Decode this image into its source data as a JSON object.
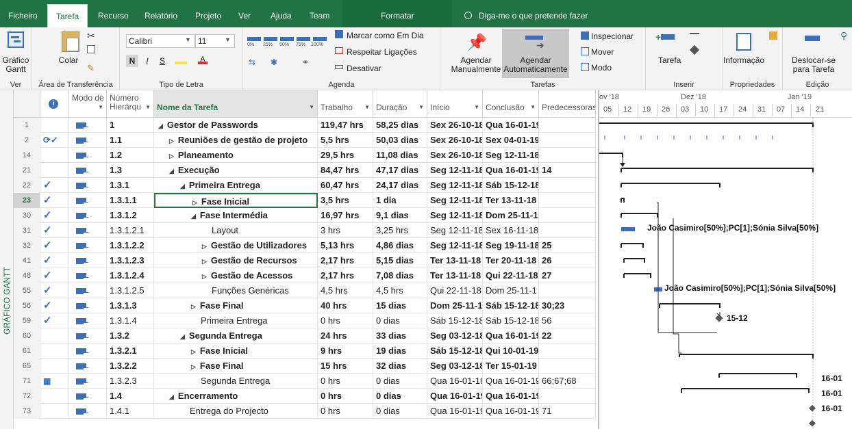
{
  "tabs": [
    "Ficheiro",
    "Tarefa",
    "Recurso",
    "Relatório",
    "Projeto",
    "Ver",
    "Ajuda",
    "Team"
  ],
  "active_tab": "Tarefa",
  "context_tab": "Formatar",
  "tell_me": "Diga-me o que pretende fazer",
  "ribbon": {
    "ver": {
      "button": "Gráfico Gantt",
      "label": "Ver"
    },
    "clipboard": {
      "paste": "Colar",
      "label": "Área de Transferência"
    },
    "font": {
      "family": "Calibri",
      "size": "11",
      "bold": "N",
      "italic": "I",
      "underline": "S",
      "label": "Tipo de Letra"
    },
    "schedule": {
      "mark": "Marcar como Em Dia",
      "respect": "Respeitar Ligações",
      "deactivate": "Desativar",
      "label": "Agenda",
      "percents": [
        "0%",
        "25%",
        "50%",
        "75%",
        "100%"
      ]
    },
    "tasks": {
      "manual": "Agendar Manualmente",
      "auto": "Agendar Automaticamente",
      "inspect": "Inspecionar",
      "move": "Mover",
      "mode": "Modo",
      "label": "Tarefas"
    },
    "insert": {
      "task": "Tarefa",
      "label": "Inserir"
    },
    "properties": {
      "info": "Informação",
      "label": "Propriedades"
    },
    "edit": {
      "scroll": "Deslocar-se para Tarefa",
      "label": "Edição"
    }
  },
  "side_label": "GRÁFICO GANTT",
  "columns": {
    "mode": "Modo de",
    "number": "Número Hierárqu",
    "name": "Nome da Tarefa",
    "work": "Trabalho",
    "duration": "Duração",
    "start": "Início",
    "finish": "Conclusão",
    "pred": "Predecessoras"
  },
  "rows": [
    {
      "id": "1",
      "ind": "",
      "num": "1",
      "indent": 0,
      "arrow": "◢",
      "name": "Gestor de Passwords",
      "work": "119,47 hrs",
      "dur": "58,25 dias",
      "start": "Sex 26-10-18",
      "finish": "Qua 16-01-19",
      "pred": "",
      "bold": true
    },
    {
      "id": "2",
      "ind": "⟳✓",
      "num": "1.1",
      "indent": 1,
      "arrow": "▷",
      "name": "Reuniões de gestão de projeto",
      "work": "5,5 hrs",
      "dur": "50,03 dias",
      "start": "Sex 26-10-18",
      "finish": "Sex 04-01-19",
      "pred": "",
      "bold": true
    },
    {
      "id": "14",
      "ind": "",
      "num": "1.2",
      "indent": 1,
      "arrow": "▷",
      "name": "Planeamento",
      "work": "29,5 hrs",
      "dur": "11,08 dias",
      "start": "Sex 26-10-18",
      "finish": "Seg 12-11-18",
      "pred": "",
      "bold": true
    },
    {
      "id": "21",
      "ind": "",
      "num": "1.3",
      "indent": 1,
      "arrow": "◢",
      "name": "Execução",
      "work": "84,47 hrs",
      "dur": "47,17 dias",
      "start": "Seg 12-11-18",
      "finish": "Qua 16-01-19",
      "pred": "14",
      "bold": true
    },
    {
      "id": "22",
      "ind": "✓",
      "num": "1.3.1",
      "indent": 2,
      "arrow": "◢",
      "name": "Primeira Entrega",
      "work": "60,47 hrs",
      "dur": "24,17 dias",
      "start": "Seg 12-11-18",
      "finish": "Sáb 15-12-18",
      "pred": "",
      "bold": true
    },
    {
      "id": "23",
      "ind": "✓",
      "num": "1.3.1.1",
      "indent": 3,
      "arrow": "▷",
      "name": "Fase Inicial",
      "work": "3,5 hrs",
      "dur": "1 dia",
      "start": "Seg 12-11-18",
      "finish": "Ter 13-11-18",
      "pred": "",
      "bold": true,
      "selected": true
    },
    {
      "id": "30",
      "ind": "✓",
      "num": "1.3.1.2",
      "indent": 3,
      "arrow": "◢",
      "name": "Fase Intermédia",
      "work": "16,97 hrs",
      "dur": "9,1 dias",
      "start": "Seg 12-11-18",
      "finish": "Dom 25-11-1",
      "pred": "",
      "bold": true
    },
    {
      "id": "31",
      "ind": "✓",
      "num": "1.3.1.2.1",
      "indent": 4,
      "arrow": "",
      "name": "Layout",
      "work": "3 hrs",
      "dur": "3,25 hrs",
      "start": "Seg 12-11-18",
      "finish": "Sex 16-11-18",
      "pred": "",
      "bold": false
    },
    {
      "id": "32",
      "ind": "✓",
      "num": "1.3.1.2.2",
      "indent": 4,
      "arrow": "▷",
      "name": "Gestão de Utilizadores",
      "work": "5,13 hrs",
      "dur": "4,86 dias",
      "start": "Seg 12-11-18",
      "finish": "Seg 19-11-18",
      "pred": "25",
      "bold": true
    },
    {
      "id": "41",
      "ind": "✓",
      "num": "1.3.1.2.3",
      "indent": 4,
      "arrow": "▷",
      "name": "Gestão de Recursos",
      "work": "2,17 hrs",
      "dur": "5,15 dias",
      "start": "Ter 13-11-18",
      "finish": "Ter 20-11-18",
      "pred": "26",
      "bold": true
    },
    {
      "id": "48",
      "ind": "✓",
      "num": "1.3.1.2.4",
      "indent": 4,
      "arrow": "▷",
      "name": "Gestão de Acessos",
      "work": "2,17 hrs",
      "dur": "7,08 dias",
      "start": "Ter 13-11-18",
      "finish": "Qui 22-11-18",
      "pred": "27",
      "bold": true
    },
    {
      "id": "55",
      "ind": "✓",
      "num": "1.3.1.2.5",
      "indent": 4,
      "arrow": "",
      "name": "Funções Genéricas",
      "work": "4,5 hrs",
      "dur": "4,5 hrs",
      "start": "Qui 22-11-18",
      "finish": "Dom 25-11-1",
      "pred": "",
      "bold": false
    },
    {
      "id": "56",
      "ind": "✓",
      "num": "1.3.1.3",
      "indent": 3,
      "arrow": "▷",
      "name": "Fase Final",
      "work": "40 hrs",
      "dur": "15 dias",
      "start": "Dom 25-11-1",
      "finish": "Sáb 15-12-18",
      "pred": "30;23",
      "bold": true
    },
    {
      "id": "59",
      "ind": "✓",
      "num": "1.3.1.4",
      "indent": 3,
      "arrow": "",
      "name": "Primeira Entrega",
      "work": "0 hrs",
      "dur": "0 dias",
      "start": "Sáb 15-12-18",
      "finish": "Sáb 15-12-18",
      "pred": "56",
      "bold": false
    },
    {
      "id": "60",
      "ind": "",
      "num": "1.3.2",
      "indent": 2,
      "arrow": "◢",
      "name": "Segunda Entrega",
      "work": "24 hrs",
      "dur": "33 dias",
      "start": "Seg 03-12-18",
      "finish": "Qua 16-01-19",
      "pred": "22",
      "bold": true
    },
    {
      "id": "61",
      "ind": "",
      "num": "1.3.2.1",
      "indent": 3,
      "arrow": "▷",
      "name": "Fase Inicial",
      "work": "9 hrs",
      "dur": "19 dias",
      "start": "Sáb 15-12-18",
      "finish": "Qui 10-01-19",
      "pred": "",
      "bold": true
    },
    {
      "id": "65",
      "ind": "",
      "num": "1.3.2.2",
      "indent": 3,
      "arrow": "▷",
      "name": "Fase Final",
      "work": "15 hrs",
      "dur": "32 dias",
      "start": "Seg 03-12-18",
      "finish": "Ter 15-01-19",
      "pred": "",
      "bold": true
    },
    {
      "id": "71",
      "ind": "▦",
      "num": "1.3.2.3",
      "indent": 3,
      "arrow": "",
      "name": "Segunda Entrega",
      "work": "0 hrs",
      "dur": "0 dias",
      "start": "Qua 16-01-19",
      "finish": "Qua 16-01-19",
      "pred": "66;67;68",
      "bold": false
    },
    {
      "id": "72",
      "ind": "",
      "num": "1.4",
      "indent": 1,
      "arrow": "◢",
      "name": "Encerramento",
      "work": "0 hrs",
      "dur": "0 dias",
      "start": "Qua 16-01-19",
      "finish": "Qua 16-01-19",
      "pred": "",
      "bold": true
    },
    {
      "id": "73",
      "ind": "",
      "num": "1.4.1",
      "indent": 2,
      "arrow": "",
      "name": "Entrega do Projecto",
      "work": "0 hrs",
      "dur": "0 dias",
      "start": "Qua 16-01-19",
      "finish": "Qua 16-01-19",
      "pred": "71",
      "bold": false
    }
  ],
  "gantt": {
    "months": [
      "ov '18",
      "Dez '18",
      "Jan '19"
    ],
    "days": [
      "05",
      "12",
      "19",
      "26",
      "03",
      "10",
      "17",
      "24",
      "31",
      "07",
      "14",
      "21"
    ],
    "resource_label": "João Casimiro[50%];PC[1];Sónia Silva[50%]",
    "milestone_1": "15-12",
    "milestone_2": "16-01",
    "milestone_3": "16-01",
    "milestone_4": "16-01"
  },
  "colors": {
    "brand": "#217346",
    "task_blue": "#3d6fb6",
    "selected_border": "#217346"
  }
}
